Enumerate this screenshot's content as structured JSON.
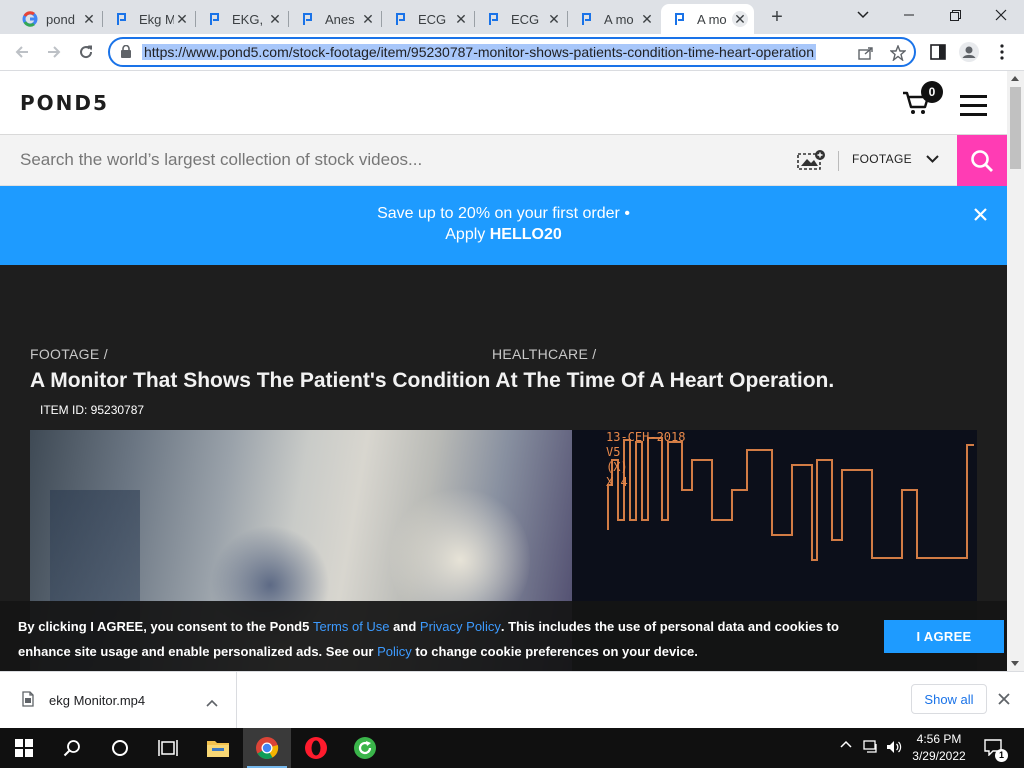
{
  "browser": {
    "tabs": [
      {
        "title": "pond",
        "favicon": "google-icon"
      },
      {
        "title": "Ekg M",
        "favicon": "pond5-icon"
      },
      {
        "title": "EKG, ",
        "favicon": "pond5-icon"
      },
      {
        "title": "Anes",
        "favicon": "pond5-icon"
      },
      {
        "title": "ECG ",
        "favicon": "pond5-icon"
      },
      {
        "title": "ECG ",
        "favicon": "pond5-icon"
      },
      {
        "title": "A mo",
        "favicon": "pond5-icon"
      },
      {
        "title": "A mo",
        "favicon": "pond5-icon",
        "active": true
      }
    ],
    "url": "https://www.pond5.com/stock-footage/item/95230787-monitor-shows-patients-condition-time-heart-operation"
  },
  "site": {
    "logo": "POND5",
    "cart_count": "0",
    "search_placeholder": "Search the world’s largest collection of stock videos...",
    "search_category": "FOOTAGE"
  },
  "promo": {
    "line1": "Save up to 20% on your first order •",
    "apply_label": "Apply",
    "code": "HELLO20"
  },
  "item": {
    "breadcrumbs": [
      "FOOTAGE /",
      "HEALTHCARE /"
    ],
    "title": "A Monitor That Shows The Patient's Condition At The Time Of A Heart Operation.",
    "item_id_label": "ITEM ID: 95230787",
    "monitor_overlay": [
      "13-СЕН-2018",
      "V5",
      "(X)",
      "X 4"
    ]
  },
  "cookie": {
    "text1": "By clicking I AGREE, you consent to the Pond5",
    "terms_link": "Terms of Use",
    "and": "and",
    "privacy_link": "Privacy Policy",
    "text2": ". This includes the use of personal data and cookies to enhance site usage and enable personalized ads. See our",
    "policy_link": "Policy",
    "text3": "to change cookie preferences on your device.",
    "agree_label": "I AGREE"
  },
  "downloads": {
    "file_name": "ekg Monitor.mp4",
    "show_all_label": "Show all"
  },
  "taskbar": {
    "time": "4:56 PM",
    "date": "3/29/2022",
    "notification_count": "1"
  },
  "colors": {
    "accent_blue": "#1e9bff",
    "search_pink": "#ff3cb4",
    "page_dark": "#1e1e1e"
  }
}
